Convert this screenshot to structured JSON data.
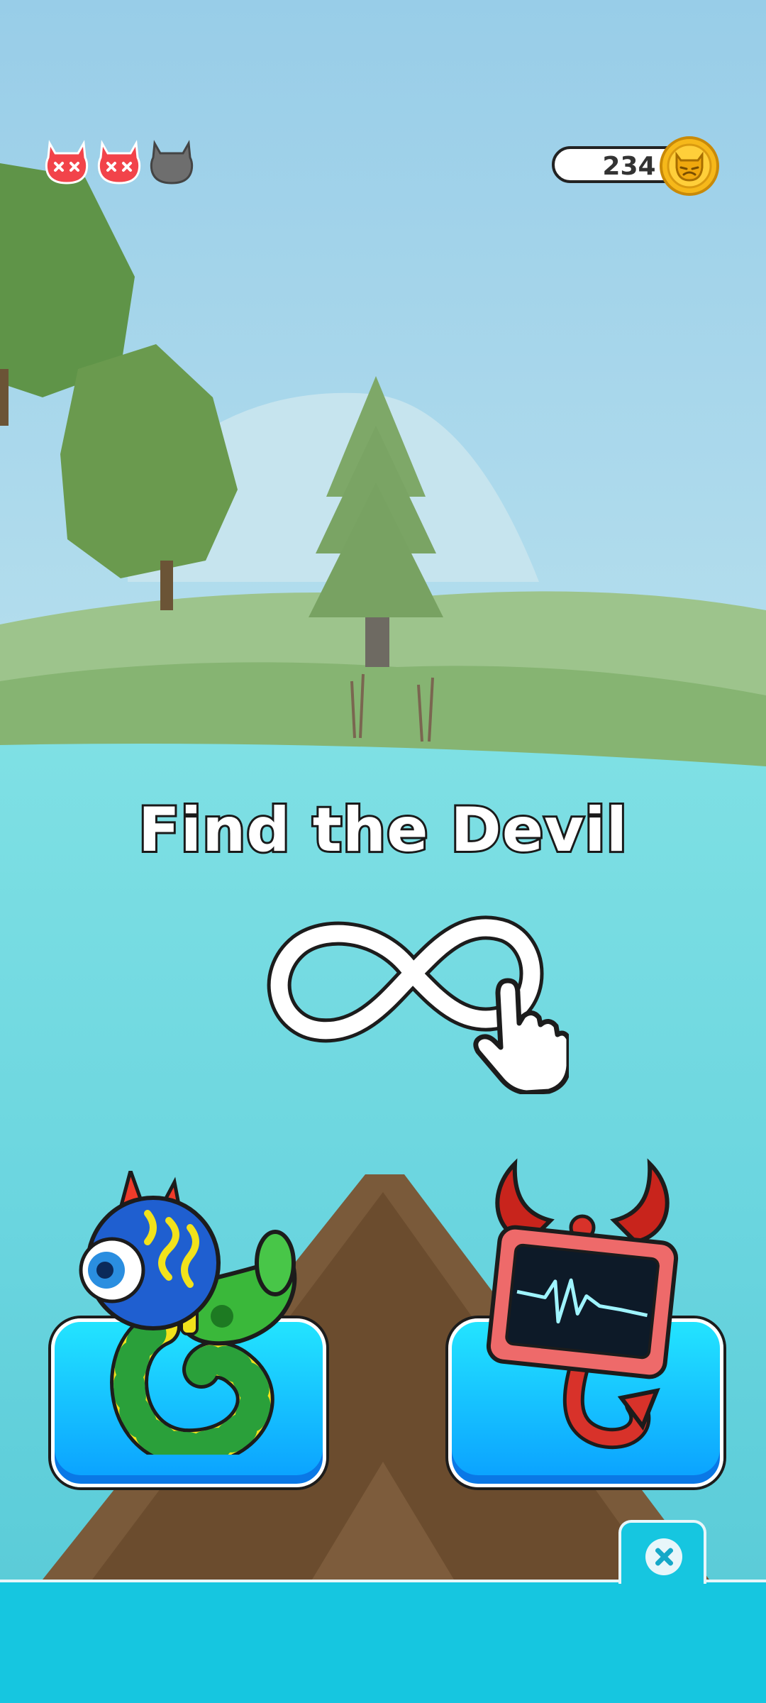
{
  "hud": {
    "lives": [
      {
        "state": "lost",
        "icon": "devil-face-x-icon"
      },
      {
        "state": "lost",
        "icon": "devil-face-x-icon"
      },
      {
        "state": "remaining",
        "icon": "devil-face-gray-icon"
      }
    ],
    "coins": "234",
    "coin_icon": "devil-coin-icon"
  },
  "prompt": {
    "title": "Find the Devil",
    "gesture_icon": "infinity-swipe-hand-icon"
  },
  "choices": [
    {
      "id": "left",
      "character": "blue-green-monster"
    },
    {
      "id": "right",
      "character": "red-devil-monitor"
    }
  ],
  "close_icon": "close-icon",
  "colors": {
    "sky": "#9fd3ea",
    "water": "#6fd7e0",
    "choice_button": "#12c9f5",
    "bottom_bar": "#16c6e0",
    "life_lost": "#f2434a",
    "life_remaining": "#6e6e6e",
    "coin": "#f6b81a"
  }
}
